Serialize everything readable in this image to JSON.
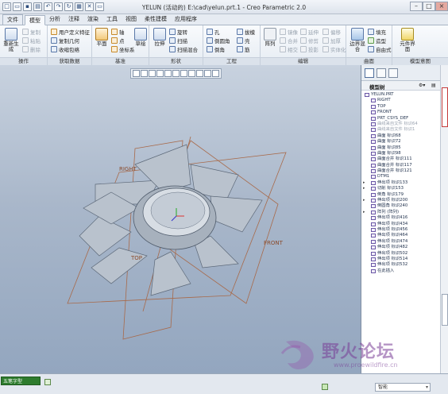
{
  "window": {
    "title": "YELUN (活动的) E:\\cad\\yelun.prt.1 - Creo Parametric 2.0",
    "controls": [
      "–",
      "□",
      "×"
    ]
  },
  "tabs": {
    "file": "文件",
    "items": [
      {
        "label": "模型",
        "active": true
      },
      {
        "label": "分析",
        "active": false
      },
      {
        "label": "注释",
        "active": false
      },
      {
        "label": "渲染",
        "active": false
      },
      {
        "label": "工具",
        "active": false
      },
      {
        "label": "视图",
        "active": false
      },
      {
        "label": "柔性建模",
        "active": false
      },
      {
        "label": "应用程序",
        "active": false
      }
    ]
  },
  "ribbon": {
    "operations": {
      "label": "操作",
      "regen": "重新生成",
      "copy": "复制",
      "paste": "粘贴",
      "delete": "删除"
    },
    "get_data": {
      "label": "获取数据",
      "udf": "用户定义特征",
      "copy_geom": "复制几何",
      "shrinkwrap": "收缩包络"
    },
    "datum": {
      "label": "基准",
      "plane": "平面",
      "axis": "轴",
      "point": "点",
      "csys": "坐标系",
      "sketch": "草绘"
    },
    "shapes": {
      "label": "形状",
      "extrude": "拉伸",
      "revolve": "旋转",
      "sweep": "扫描",
      "swept_blend": "扫描混合"
    },
    "engineering": {
      "label": "工程",
      "hole": "孔",
      "round": "倒圆角",
      "chamfer": "倒角",
      "draft": "拔模",
      "shell": "壳",
      "rib": "筋"
    },
    "editing": {
      "label": "编辑",
      "pattern": "阵列",
      "mirror": "镜像",
      "extend": "延伸",
      "merge": "合并",
      "trim": "修剪",
      "offset": "偏移",
      "intersect": "相交",
      "project": "投影",
      "thicken": "加厚",
      "solidify": "实体化"
    },
    "surfaces": {
      "label": "曲面",
      "fill": "填充",
      "boundary_blend": "边界混合",
      "style": "造型",
      "freestyle": "自由式"
    },
    "model_intent": {
      "label": "模型意图",
      "component_interface": "元件界面"
    }
  },
  "viewport": {
    "planes": {
      "right": "RIGHT",
      "front": "FRONT",
      "top": "TOP"
    }
  },
  "side_panel": {
    "title": "模型树",
    "tree": [
      {
        "label": "YELUN.PRT",
        "indent": 0,
        "exp": ""
      },
      {
        "label": "RIGHT",
        "indent": 1,
        "exp": ""
      },
      {
        "label": "TOP",
        "indent": 1,
        "exp": ""
      },
      {
        "label": "FRONT",
        "indent": 1,
        "exp": ""
      },
      {
        "label": "PRT_CSYS_DEF",
        "indent": 1,
        "exp": ""
      },
      {
        "label": "曲线来自文件 标识64",
        "indent": 1,
        "exp": "",
        "dim": true
      },
      {
        "label": "曲线来自文件 标识1",
        "indent": 1,
        "exp": "",
        "dim": true
      },
      {
        "label": "曲面 标识68",
        "indent": 1,
        "exp": ""
      },
      {
        "label": "曲面 标识72",
        "indent": 1,
        "exp": ""
      },
      {
        "label": "曲面 标识85",
        "indent": 1,
        "exp": ""
      },
      {
        "label": "曲面 标识98",
        "indent": 1,
        "exp": ""
      },
      {
        "label": "曲面合并 标识111",
        "indent": 1,
        "exp": ""
      },
      {
        "label": "曲面合并 标识117",
        "indent": 1,
        "exp": ""
      },
      {
        "label": "曲面合并 标识121",
        "indent": 1,
        "exp": ""
      },
      {
        "label": "DTM1",
        "indent": 1,
        "exp": ""
      },
      {
        "label": "伸出项 标识133",
        "indent": 1,
        "exp": "▸"
      },
      {
        "label": "切削 标识153",
        "indent": 1,
        "exp": "▸"
      },
      {
        "label": "倒角 标识179",
        "indent": 1,
        "exp": ""
      },
      {
        "label": "伸出项 标识200",
        "indent": 1,
        "exp": "▸"
      },
      {
        "label": "倒圆角 标识240",
        "indent": 1,
        "exp": ""
      },
      {
        "label": "阵列 (阵列)",
        "indent": 1,
        "exp": "▸"
      },
      {
        "label": "伸出项 标识416",
        "indent": 1,
        "exp": ""
      },
      {
        "label": "伸出项 标识434",
        "indent": 1,
        "exp": ""
      },
      {
        "label": "伸出项 标识456",
        "indent": 1,
        "exp": ""
      },
      {
        "label": "伸出项 标识464",
        "indent": 1,
        "exp": ""
      },
      {
        "label": "伸出项 标识474",
        "indent": 1,
        "exp": ""
      },
      {
        "label": "伸出项 标识482",
        "indent": 1,
        "exp": ""
      },
      {
        "label": "伸出项 标识502",
        "indent": 1,
        "exp": ""
      },
      {
        "label": "伸出项 标识514",
        "indent": 1,
        "exp": ""
      },
      {
        "label": "伸出项 标识532",
        "indent": 1,
        "exp": ""
      },
      {
        "label": "在此插入",
        "indent": 1,
        "exp": ""
      }
    ]
  },
  "watermark": {
    "title": "野火论坛",
    "url": "www.proewildfire.cn"
  },
  "statusbar": {
    "ime": "五笔字型",
    "select_filter": "智能"
  }
}
